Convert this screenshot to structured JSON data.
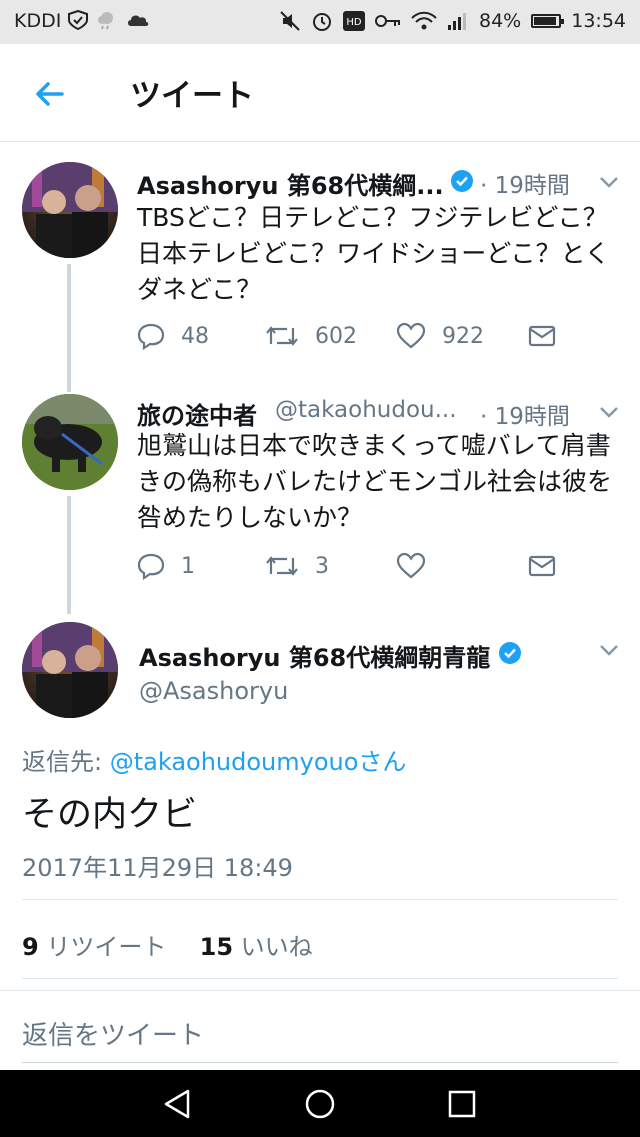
{
  "status_bar": {
    "carrier": "KDDI",
    "battery": "84%",
    "time": "13:54",
    "battery_level": 0.84
  },
  "header": {
    "title": "ツイート"
  },
  "tweets": [
    {
      "name": "Asashoryu 第68代横綱...",
      "time": "· 19時間",
      "text": "TBSどこ？日テレどこ？フジテレビどこ？日本テレビどこ？ワイドショーどこ？とくダネどこ？",
      "replies": "48",
      "retweets": "602",
      "likes": "922"
    },
    {
      "name": "旅の途中者",
      "handle": "@takaohudou...",
      "time": "· 19時間",
      "text": "旭鷲山は日本で吹きまくって嘘バレて肩書きの偽称もバレたけどモンゴル社会は彼を咎めたりしないか？",
      "replies": "1",
      "retweets": "3",
      "likes": ""
    }
  ],
  "focused": {
    "name": "Asashoryu 第68代横綱朝青龍",
    "handle": "@Asashoryu",
    "reply_to_label": "返信先: ",
    "reply_to_user": "@takaohudoumyouo",
    "reply_to_suffix": "さん",
    "text": "その内クビ",
    "date": "2017年11月29日 18:49",
    "retweet_count": "9",
    "retweet_label": "リツイート",
    "like_count": "15",
    "like_label": "いいね"
  },
  "reply_box": {
    "placeholder": "返信をツイート"
  },
  "colors": {
    "accent": "#1da1f2",
    "muted": "#657786",
    "text": "#14171a"
  }
}
